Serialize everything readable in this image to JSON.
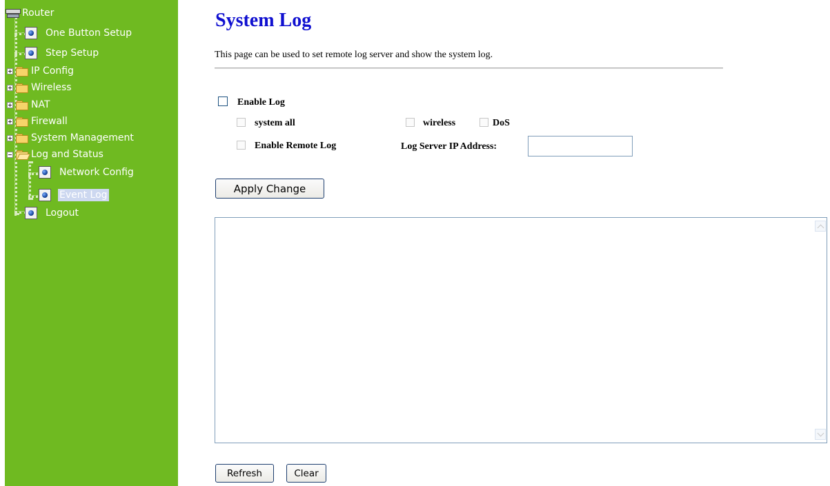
{
  "sidebar": {
    "root_label": "Router",
    "items": [
      {
        "label": "One Button Setup",
        "icon": "page-icon"
      },
      {
        "label": "Step Setup",
        "icon": "page-icon"
      },
      {
        "label": "IP Config",
        "icon": "folder-icon",
        "expander": "plus"
      },
      {
        "label": "Wireless",
        "icon": "folder-icon",
        "expander": "plus"
      },
      {
        "label": "NAT",
        "icon": "folder-icon",
        "expander": "plus"
      },
      {
        "label": "Firewall",
        "icon": "folder-icon",
        "expander": "plus"
      },
      {
        "label": "System Management",
        "icon": "folder-icon",
        "expander": "plus"
      },
      {
        "label": "Log and Status",
        "icon": "open-folder-icon",
        "expander": "minus",
        "children": [
          {
            "label": "Network Config",
            "icon": "page-icon"
          },
          {
            "label": "Event Log",
            "icon": "page-icon",
            "selected": true
          }
        ]
      },
      {
        "label": "Logout",
        "icon": "page-icon"
      }
    ],
    "background_color": "#6fba21"
  },
  "main": {
    "title": "System Log",
    "title_color": "#1010d0",
    "description": "This page can be used to set remote log server and show the system log.",
    "form": {
      "enable_log": {
        "label": "Enable Log",
        "checked": false
      },
      "system_all": {
        "label": "system all",
        "checked": false,
        "disabled": true
      },
      "wireless": {
        "label": "wireless",
        "checked": false,
        "disabled": true
      },
      "dos": {
        "label": "DoS",
        "checked": false,
        "disabled": true
      },
      "enable_remote_log": {
        "label": "Enable Remote Log",
        "checked": false,
        "disabled": true
      },
      "log_server_ip": {
        "label": "Log Server IP Address:",
        "value": ""
      }
    },
    "apply_button_label": "Apply Change",
    "log_text": "",
    "refresh_button_label": "Refresh",
    "clear_button_label": "Clear"
  }
}
